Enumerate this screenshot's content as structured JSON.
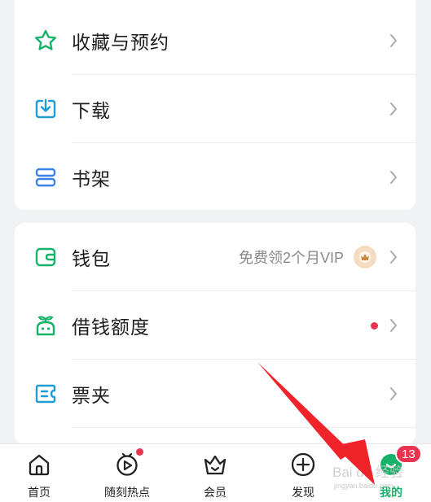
{
  "menu_group_1": {
    "items": [
      {
        "label": "收藏与预约",
        "icon": "star-icon"
      },
      {
        "label": "下载",
        "icon": "download-icon"
      },
      {
        "label": "书架",
        "icon": "bookshelf-icon"
      }
    ]
  },
  "menu_group_2": {
    "items": [
      {
        "label": "钱包",
        "icon": "wallet-icon",
        "extra": "免费领2个月VIP"
      },
      {
        "label": "借钱额度",
        "icon": "sprout-icon"
      },
      {
        "label": "票夹",
        "icon": "ticket-icon"
      }
    ]
  },
  "tabbar": {
    "tabs": [
      {
        "label": "首页",
        "icon": "home-icon"
      },
      {
        "label": "随刻热点",
        "icon": "play-icon"
      },
      {
        "label": "会员",
        "icon": "crown-icon"
      },
      {
        "label": "发现",
        "icon": "plus-icon"
      },
      {
        "label": "我的",
        "icon": "profile-icon"
      }
    ],
    "profile_badge": "13"
  },
  "watermark": {
    "text": "Bai du 经验",
    "sub": "jingyan.baidu.com"
  },
  "colors": {
    "accent_green": "#17b26a",
    "icon_blue": "#1f9cd6",
    "badge_red": "#e8344f"
  }
}
